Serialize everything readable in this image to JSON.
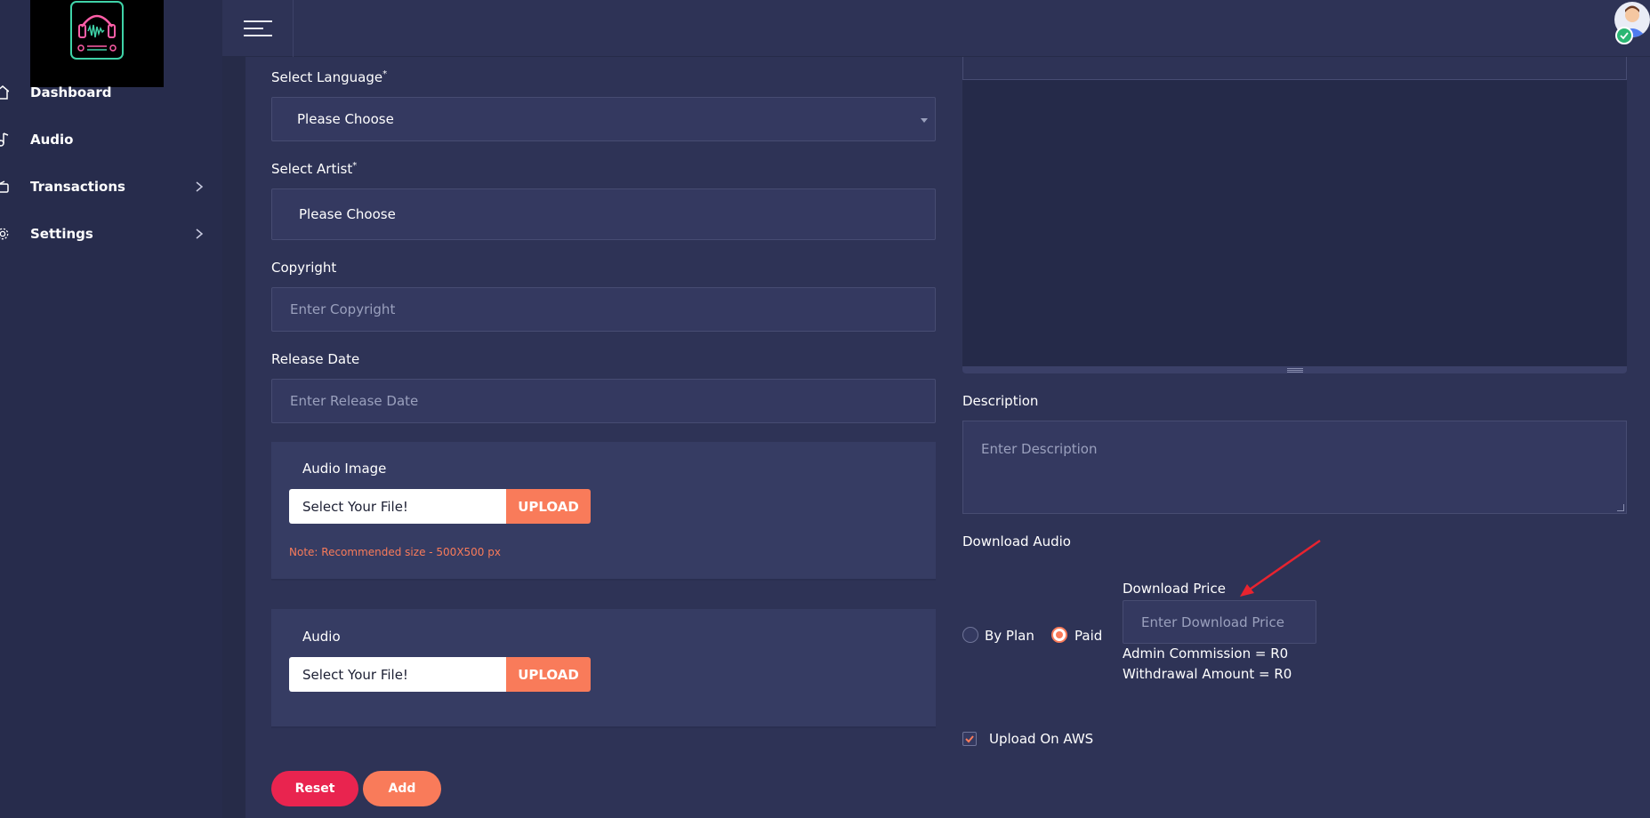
{
  "sidebar": {
    "items": [
      {
        "label": "Dashboard",
        "icon": "home-icon"
      },
      {
        "label": "Audio",
        "icon": "music-note-icon"
      },
      {
        "label": "Transactions",
        "icon": "wallet-icon"
      },
      {
        "label": "Settings",
        "icon": "gear-icon"
      }
    ]
  },
  "form": {
    "language": {
      "label": "Select Language",
      "required": "*",
      "value": "Please Choose"
    },
    "artist": {
      "label": "Select Artist",
      "required": "*",
      "value": "Please Choose"
    },
    "copyright": {
      "label": "Copyright",
      "placeholder": "Enter Copyright"
    },
    "release_date": {
      "label": "Release Date",
      "placeholder": "Enter Release Date"
    },
    "audio_image": {
      "title": "Audio Image",
      "file_placeholder": "Select Your File!",
      "upload_label": "UPLOAD",
      "note": "Note: Recommended size - 500X500 px"
    },
    "audio": {
      "title": "Audio",
      "file_placeholder": "Select Your File!",
      "upload_label": "UPLOAD"
    },
    "reset_label": "Reset",
    "add_label": "Add"
  },
  "right": {
    "description": {
      "label": "Description",
      "placeholder": "Enter Description"
    },
    "download_audio": {
      "label": "Download Audio"
    },
    "options": {
      "by_plan": "By Plan",
      "paid": "Paid",
      "selected": "Paid"
    },
    "download_price": {
      "label": "Download Price",
      "placeholder": "Enter Download Price"
    },
    "admin_commission": "Admin Commission = R0",
    "withdrawal_amount": "Withdrawal Amount = R0",
    "upload_aws": {
      "label": "Upload On AWS",
      "checked": true
    }
  },
  "colors": {
    "accent": "#f97b5a",
    "danger": "#e9244f",
    "bg": "#2e3356",
    "sidebar": "#272c4c"
  }
}
